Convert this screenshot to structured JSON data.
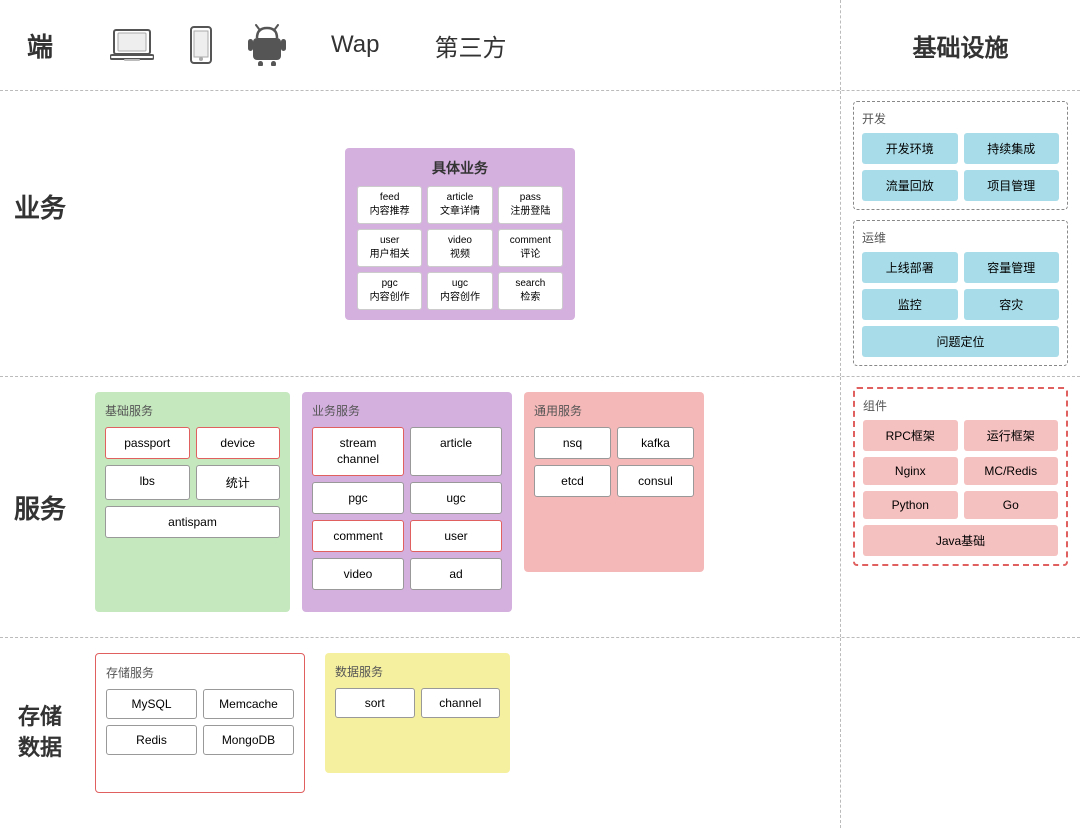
{
  "top": {
    "label": "端",
    "devices": [
      {
        "name": "laptop",
        "icon": "💻"
      },
      {
        "name": "phone",
        "icon": "📱"
      },
      {
        "name": "android",
        "icon": "🤖"
      }
    ],
    "wap": "Wap",
    "thirdparty": "第三方"
  },
  "business": {
    "label": "业务",
    "specific": {
      "title": "具体业务",
      "items": [
        {
          "top": "feed",
          "bottom": "内容推荐"
        },
        {
          "top": "article",
          "bottom": "文章详情"
        },
        {
          "top": "pass",
          "bottom": "注册登陆"
        },
        {
          "top": "user",
          "bottom": "用户相关"
        },
        {
          "top": "video",
          "bottom": "视频"
        },
        {
          "top": "comment",
          "bottom": "评论"
        },
        {
          "top": "pgc",
          "bottom": "内容创作"
        },
        {
          "top": "ugc",
          "bottom": "内容创作"
        },
        {
          "top": "search",
          "bottom": "检索"
        }
      ]
    }
  },
  "service": {
    "label": "服务",
    "base": {
      "title": "基础服务",
      "items": [
        {
          "label": "passport",
          "highlight": true
        },
        {
          "label": "device",
          "highlight": true
        },
        {
          "label": "lbs",
          "highlight": false
        },
        {
          "label": "统计",
          "highlight": false
        },
        {
          "label": "antispam",
          "highlight": false,
          "full": true
        }
      ]
    },
    "biz": {
      "title": "业务服务",
      "items": [
        {
          "label": "stream channel",
          "highlight": true
        },
        {
          "label": "article",
          "highlight": false
        },
        {
          "label": "pgc",
          "highlight": false
        },
        {
          "label": "ugc",
          "highlight": false
        },
        {
          "label": "comment",
          "highlight": true
        },
        {
          "label": "user",
          "highlight": true
        },
        {
          "label": "video",
          "highlight": false
        },
        {
          "label": "ad",
          "highlight": false
        }
      ]
    },
    "common": {
      "title": "通用服务",
      "items": [
        {
          "label": "nsq"
        },
        {
          "label": "kafka"
        },
        {
          "label": "etcd"
        },
        {
          "label": "consul"
        }
      ]
    }
  },
  "storage": {
    "label": "存储\n数据",
    "store": {
      "title": "存储服务",
      "items": [
        {
          "label": "MySQL"
        },
        {
          "label": "Memcache"
        },
        {
          "label": "Redis"
        },
        {
          "label": "MongoDB"
        }
      ]
    },
    "data": {
      "title": "数据服务",
      "items": [
        {
          "label": "sort"
        },
        {
          "label": "channel"
        }
      ]
    }
  },
  "infra": {
    "title": "基础设施",
    "dev": {
      "label": "开发",
      "items": [
        {
          "label": "开发环境"
        },
        {
          "label": "持续集成"
        },
        {
          "label": "流量回放"
        },
        {
          "label": "项目管理"
        }
      ]
    },
    "ops": {
      "label": "运维",
      "items": [
        {
          "label": "上线部署"
        },
        {
          "label": "容量管理"
        },
        {
          "label": "监控"
        },
        {
          "label": "容灾"
        },
        {
          "label": "问题定位"
        }
      ]
    },
    "comp": {
      "label": "组件",
      "items": [
        {
          "label": "RPC框架"
        },
        {
          "label": "运行框架"
        },
        {
          "label": "Nginx"
        },
        {
          "label": "MC/Redis"
        },
        {
          "label": "Python"
        },
        {
          "label": "Go"
        },
        {
          "label": "Java基础",
          "full": true
        }
      ]
    }
  }
}
